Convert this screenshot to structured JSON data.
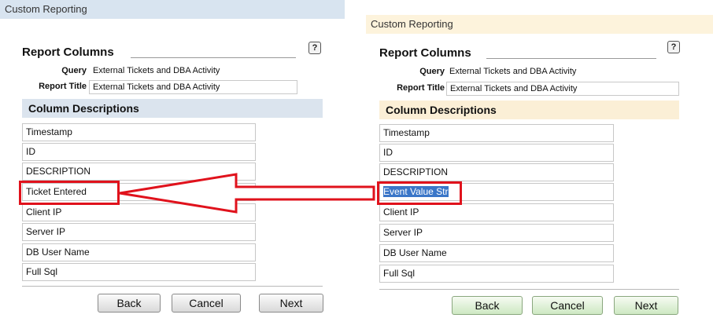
{
  "left": {
    "header": "Custom Reporting",
    "help": "?",
    "section_title": "Report Columns",
    "query_label": "Query",
    "query_value": "External Tickets and DBA Activity",
    "title_label": "Report Title",
    "title_value": "External Tickets and DBA Activity",
    "col_desc": "Column Descriptions",
    "rows": [
      "Timestamp",
      "ID",
      "DESCRIPTION",
      "Ticket Entered",
      "Client IP",
      "Server IP",
      "DB User Name",
      "Full Sql"
    ],
    "buttons": {
      "back": "Back",
      "cancel": "Cancel",
      "next": "Next"
    }
  },
  "right": {
    "header": "Custom Reporting",
    "help": "?",
    "section_title": "Report Columns",
    "query_label": "Query",
    "query_value": "External Tickets and DBA Activity",
    "title_label": "Report Title",
    "title_value": "External Tickets and DBA Activity",
    "col_desc": "Column Descriptions",
    "rows": [
      "Timestamp",
      "ID",
      "DESCRIPTION",
      "Event Value Str",
      "Client IP",
      "Server IP",
      "DB User Name",
      "Full Sql"
    ],
    "buttons": {
      "back": "Back",
      "cancel": "Cancel",
      "next": "Next"
    }
  },
  "colors": {
    "left_header_bg": "#d8e4f0",
    "right_header_bg": "#fdf3dc",
    "left_coldesc_bg": "#dbe4ee",
    "right_coldesc_bg": "#fbefd6",
    "highlight": "#e0121c",
    "selection": "#3a76c8"
  }
}
